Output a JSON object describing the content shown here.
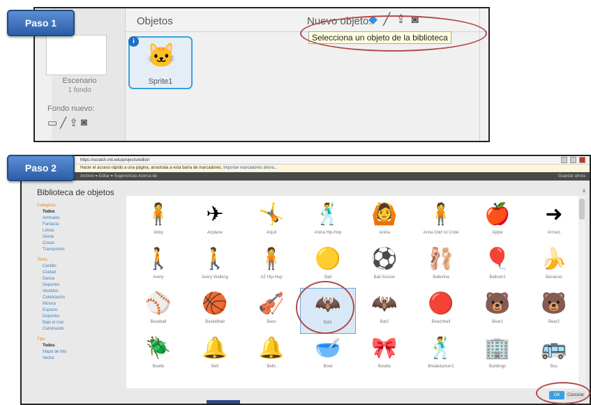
{
  "step1": {
    "badge": "Paso 1",
    "objects_title": "Objetos",
    "stage_name": "Escenario",
    "stage_backdrops": "1 fondo",
    "new_backdrop_label": "Fondo nuevo:",
    "new_object_label": "Nuevo objeto:",
    "new_object_tooltip": "Selecciona un objeto de la biblioteca",
    "sprite": {
      "name": "Sprite1",
      "icon": "cat-sprite",
      "info": "i"
    }
  },
  "step2": {
    "badge": "Paso 2",
    "address": "https://scratch.mit.edu/projects/editor/",
    "infobar": "Hacer el acceso rápido a una página, arrastrala a esta barra de marcadores.",
    "infobar_link": "Importar marcadores ahora...",
    "menubar": "Archivo ▾   Editar ▾   Sugerencias   Acerca de",
    "menubar_right": "Guardar ahora",
    "dialog_title": "Biblioteca de objetos",
    "close": "x",
    "category_groups": [
      {
        "heading": "Categoría",
        "items": [
          "Todos",
          "Animales",
          "Fantasía",
          "Letras",
          "Gente",
          "Cosas",
          "Transportes"
        ],
        "selected": "Todos"
      },
      {
        "heading": "Tema",
        "items": [
          "Castillo",
          "Ciudad",
          "Danza",
          "Deportes",
          "Vestidos",
          "Celebración",
          "Música",
          "Espacio",
          "Deportes",
          "Bajo el mar",
          "Caminando"
        ]
      },
      {
        "heading": "Tipo",
        "items": [
          "Todos",
          "Mapa de bits",
          "Vector"
        ],
        "selected": "Todos"
      }
    ],
    "sprites": [
      [
        "Abby",
        "Airplane",
        "Anjuli",
        "Anina Hip-Hop",
        "Anina",
        "Anna Odd Ist Cride",
        "Apple",
        "Arrow1"
      ],
      [
        "Avery",
        "Avery Walking",
        "AZ Hip-Hop",
        "Ball",
        "Ball-Soccer",
        "Ballerina",
        "Balloon1",
        "Bananas"
      ],
      [
        "Baseball",
        "Basketball",
        "Bass",
        "Bat1",
        "Bat2",
        "Beachball",
        "Bear1",
        "Bear2"
      ],
      [
        "Beetle",
        "Bell",
        "Bells",
        "Bowl",
        "Bowtie",
        "Breakdancer1",
        "Buildings",
        "Bus"
      ]
    ],
    "highlighted": "Bat1",
    "ok_label": "OK",
    "cancel_label": "Cancelar"
  },
  "colors": {
    "badge": "#2c5ea8",
    "ring": "#b24a4a",
    "selection": "#3aa0e0"
  }
}
